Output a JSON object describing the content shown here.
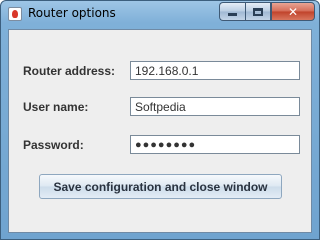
{
  "window": {
    "title": "Router options",
    "minimize_icon": "minimize-icon",
    "maximize_icon": "maximize-icon",
    "close_icon": "close-icon",
    "close_glyph": "✕"
  },
  "form": {
    "router_address": {
      "label": "Router address:",
      "value": "192.168.0.1"
    },
    "user_name": {
      "label": "User name:",
      "value": "Softpedia"
    },
    "password": {
      "label": "Password:",
      "value": "●●●●●●●●"
    },
    "submit_label": "Save configuration and close window"
  },
  "colors": {
    "titlebar_accent": "#7fb0d8",
    "client_background": "#eeeeee",
    "close_button": "#c0422a"
  }
}
